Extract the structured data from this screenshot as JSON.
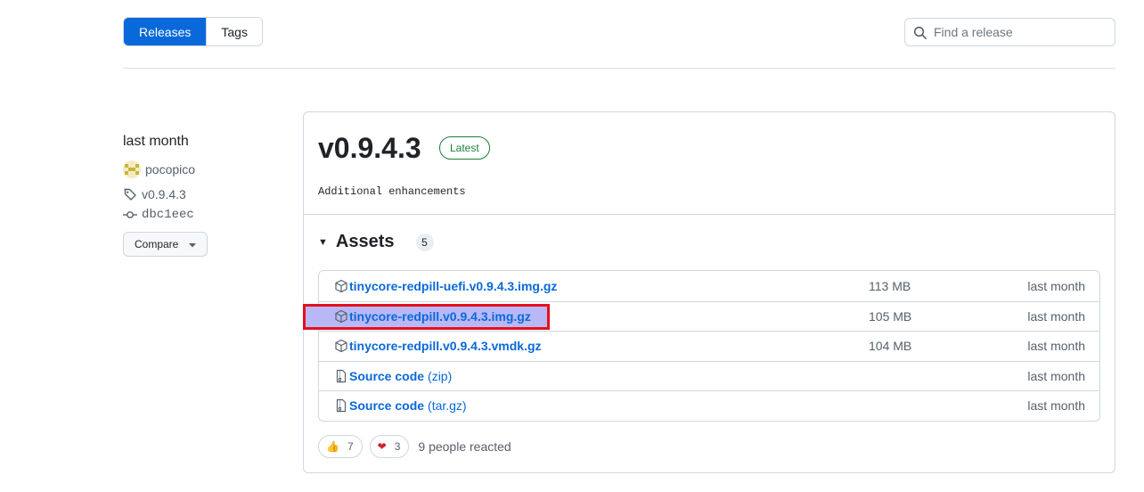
{
  "tabs": [
    {
      "label": "Releases",
      "active": true
    },
    {
      "label": "Tags",
      "active": false
    }
  ],
  "search": {
    "placeholder": "Find a release",
    "icon": "search-icon"
  },
  "sidebar": {
    "date": "last month",
    "author": "pocopico",
    "tag": "v0.9.4.3",
    "commit": "dbc1eec",
    "compare_label": "Compare"
  },
  "release": {
    "title": "v0.9.4.3",
    "badge": "Latest",
    "body": "Additional enhancements"
  },
  "assets": {
    "label": "Assets",
    "count": "5",
    "items": [
      {
        "name": "tinycore-redpill-uefi.v0.9.4.3.img.gz",
        "suffix": "",
        "size": "113 MB",
        "time": "last month",
        "icon": "package-icon",
        "highlighted": false
      },
      {
        "name": "tinycore-redpill.v0.9.4.3.img.gz",
        "suffix": "",
        "size": "105 MB",
        "time": "last month",
        "icon": "package-icon",
        "highlighted": true
      },
      {
        "name": "tinycore-redpill.v0.9.4.3.vmdk.gz",
        "suffix": "",
        "size": "104 MB",
        "time": "last month",
        "icon": "package-icon",
        "highlighted": false
      },
      {
        "name": "Source code",
        "suffix": "(zip)",
        "size": "",
        "time": "last month",
        "icon": "file-zip-icon",
        "highlighted": false
      },
      {
        "name": "Source code",
        "suffix": "(tar.gz)",
        "size": "",
        "time": "last month",
        "icon": "file-zip-icon",
        "highlighted": false
      }
    ]
  },
  "reactions": {
    "items": [
      {
        "emoji": "👍",
        "count": "7",
        "icon": "thumbs-up-icon"
      },
      {
        "emoji": "❤",
        "count": "3",
        "icon": "heart-icon"
      }
    ],
    "summary": "9 people reacted"
  },
  "colors": {
    "accent": "#0969da",
    "success": "#1a7f37",
    "highlight_fill": "#b8b8f6",
    "highlight_border": "#e5101e"
  }
}
